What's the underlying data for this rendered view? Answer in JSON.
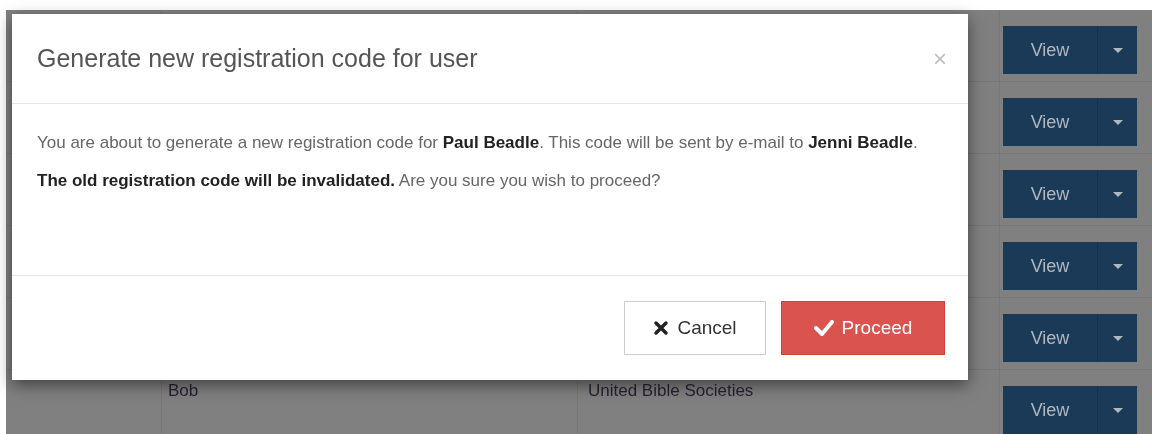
{
  "table": {
    "rows": [
      {
        "button": "View"
      },
      {
        "button": "View"
      },
      {
        "button": "View"
      },
      {
        "button": "View"
      },
      {
        "button": "View"
      },
      {
        "column_2": "Bob",
        "column_3": "United Bible Societies",
        "button": "View"
      }
    ]
  },
  "dialog": {
    "title": "Generate new registration code for user",
    "close": "×",
    "paragraphs": [
      "You are about to generate a new registration code for **Paul Beadle**. This code will be sent by e-mail to **Jenni Beadle**.",
      "**The old registration code will be invalidated.** Are you sure you wish to proceed?"
    ],
    "buttons": [
      {
        "kind": "cancel",
        "label": "Cancel"
      },
      {
        "kind": "proceed",
        "label": "Proceed"
      }
    ]
  }
}
